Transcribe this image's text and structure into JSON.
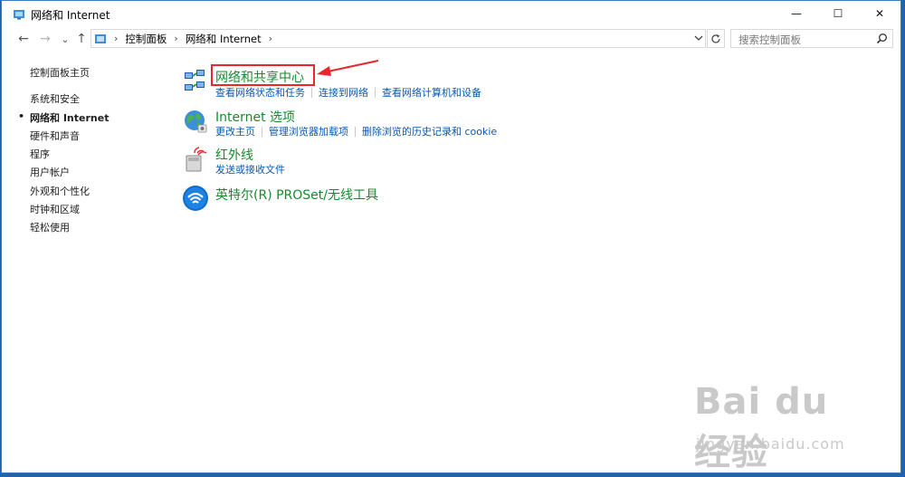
{
  "window": {
    "title": "网络和 Internet",
    "minimize_glyph": "—",
    "maximize_glyph": "☐",
    "close_glyph": "✕"
  },
  "nav": {
    "back_glyph": "←",
    "forward_glyph": "→",
    "recent_glyph": "⌄",
    "up_glyph": "↑",
    "breadcrumb": [
      "控制面板",
      "网络和 Internet"
    ],
    "separator": "›",
    "search_placeholder": "搜索控制面板"
  },
  "sidebar": {
    "items": [
      {
        "label": "控制面板主页",
        "active": false
      },
      {
        "label": "系统和安全",
        "active": false
      },
      {
        "label": "网络和 Internet",
        "active": true
      },
      {
        "label": "硬件和声音",
        "active": false
      },
      {
        "label": "程序",
        "active": false
      },
      {
        "label": "用户帐户",
        "active": false
      },
      {
        "label": "外观和个性化",
        "active": false
      },
      {
        "label": "时钟和区域",
        "active": false
      },
      {
        "label": "轻松使用",
        "active": false
      }
    ],
    "bullet": "•"
  },
  "groups": [
    {
      "title": "网络和共享中心",
      "icon": "network-sharing-icon",
      "links": [
        "查看网络状态和任务",
        "连接到网络",
        "查看网络计算机和设备"
      ]
    },
    {
      "title": "Internet 选项",
      "icon": "internet-options-icon",
      "links": [
        "更改主页",
        "管理浏览器加载项",
        "删除浏览的历史记录和 cookie"
      ]
    },
    {
      "title": "红外线",
      "icon": "infrared-icon",
      "links": [
        "发送或接收文件"
      ]
    },
    {
      "title": "英特尔(R) PROSet/无线工具",
      "icon": "wireless-icon",
      "links": []
    }
  ],
  "watermark": {
    "main": "Bai  du 经验",
    "sub": "jingyan.baidu.com"
  },
  "colors": {
    "title_green": "#178a2c",
    "link_blue": "#0a58b0",
    "highlight_red": "#e8262c",
    "desktop_blue": "#1e63b0"
  }
}
